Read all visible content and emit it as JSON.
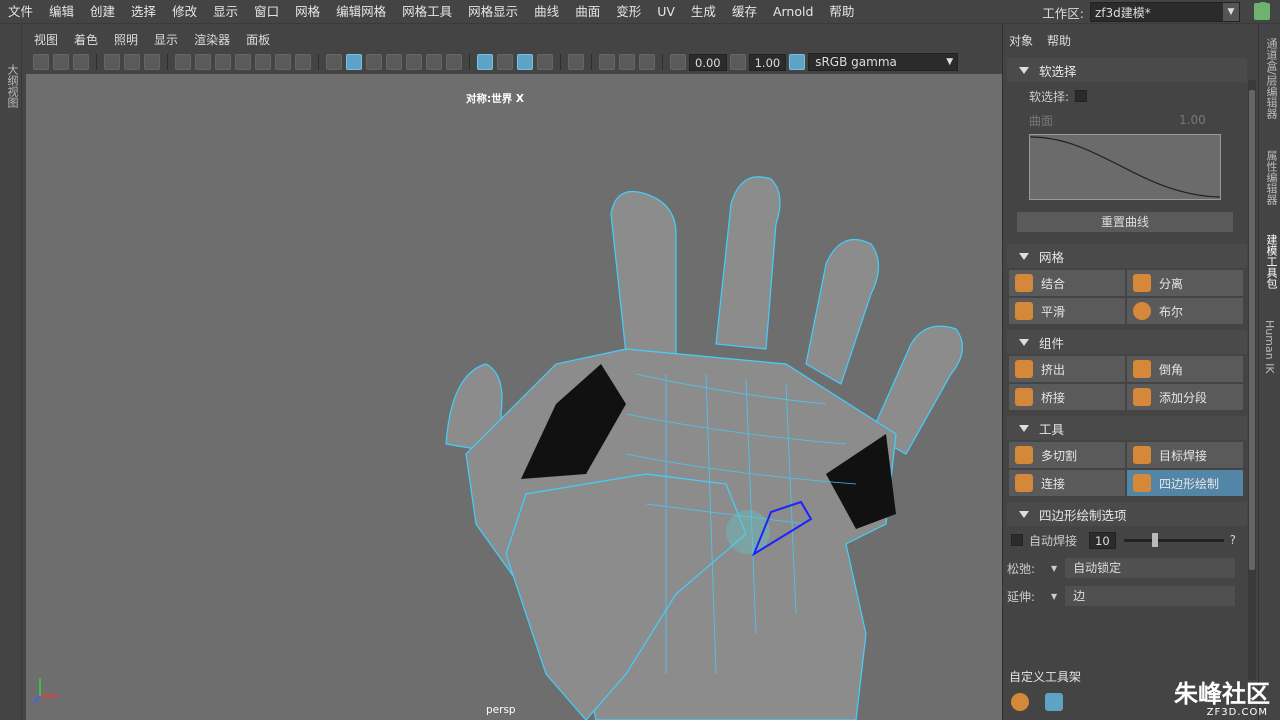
{
  "menubar": {
    "items": [
      "文件",
      "编辑",
      "创建",
      "选择",
      "修改",
      "显示",
      "窗口",
      "网格",
      "编辑网格",
      "网格工具",
      "网格显示",
      "曲线",
      "曲面",
      "变形",
      "UV",
      "生成",
      "缓存",
      "Arnold",
      "帮助"
    ]
  },
  "workspace": {
    "label": "工作区:",
    "value": "zf3d建模*"
  },
  "left_strip": {
    "label": "大纲视图"
  },
  "panel_menu": [
    "视图",
    "着色",
    "照明",
    "显示",
    "渲染器",
    "面板"
  ],
  "toolbar": {
    "exposure": "0.00",
    "gamma": "1.00",
    "colorspace": "sRGB gamma"
  },
  "viewport": {
    "title": "对称:世界 X",
    "camera": "persp"
  },
  "right_panel": {
    "menu": [
      "对象",
      "帮助"
    ],
    "soft_select": {
      "header": "软选择",
      "checkbox_label": "软选择:",
      "falloff": "曲面",
      "falloff_value": "1.00",
      "reset_label": "重置曲线"
    },
    "mesh": {
      "header": "网格",
      "buttons": [
        "结合",
        "分离",
        "平滑",
        "布尔"
      ]
    },
    "components": {
      "header": "组件",
      "buttons": [
        "挤出",
        "倒角",
        "桥接",
        "添加分段"
      ]
    },
    "tools": {
      "header": "工具",
      "buttons": [
        "多切割",
        "目标焊接",
        "连接",
        "四边形绘制"
      ],
      "selected": "四边形绘制"
    },
    "quad_draw": {
      "header": "四边形绘制选项",
      "auto_weld_label": "自动焊接",
      "auto_weld_value": "10",
      "help": "?",
      "relax_label": "松弛:",
      "relax_value": "自动锁定",
      "extend_label": "延伸:",
      "extend_value": "边"
    },
    "shelf": {
      "header": "自定义工具架"
    }
  },
  "side_tabs": [
    "通道盒/层编辑器",
    "属性编辑器",
    "建模工具包",
    "Human IK"
  ],
  "logo": {
    "text": "朱峰社区",
    "url": "ZF3D.COM"
  },
  "colors": {
    "accent": "#5ea3c6",
    "wire": "#40d0ff",
    "selected": "#5285a6",
    "icon": "#d6883a"
  }
}
